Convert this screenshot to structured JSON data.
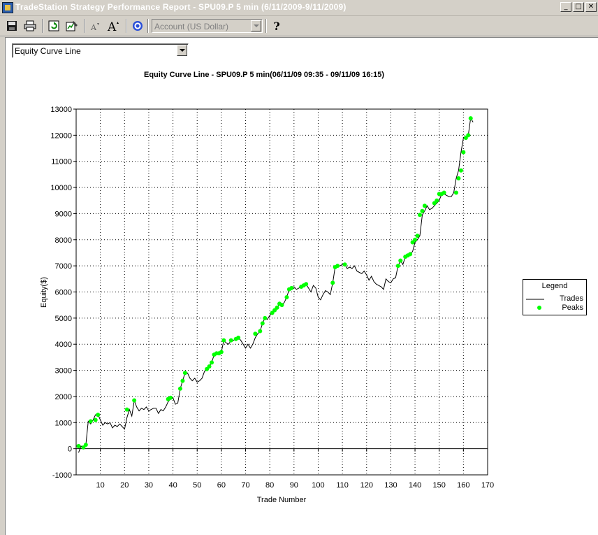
{
  "window": {
    "title": "TradeStation Strategy Performance Report - SPU09.P 5 min (6/11/2009-9/11/2009)",
    "minimize": "_",
    "maximize": "□",
    "close": "✕"
  },
  "toolbar": {
    "account_select": "Account (US Dollar)",
    "icons": [
      "save-icon",
      "print-icon",
      "refresh-icon",
      "settings-icon",
      "font-smaller-icon",
      "font-larger-icon",
      "target-icon",
      "help-icon"
    ],
    "help": "?"
  },
  "view_select": {
    "value": "Equity Curve Line"
  },
  "chart_data": {
    "type": "line",
    "title": "Equity Curve Line - SPU09.P 5 min(06/11/09 09:35 - 09/11/09 16:15)",
    "xlabel": "Trade Number",
    "ylabel": "Equity($)",
    "xlim": [
      0,
      170
    ],
    "ylim": [
      -1000,
      13000
    ],
    "xticks": [
      10,
      20,
      30,
      40,
      50,
      60,
      70,
      80,
      90,
      100,
      110,
      120,
      130,
      140,
      150,
      160,
      170
    ],
    "yticks": [
      -1000,
      0,
      1000,
      2000,
      3000,
      4000,
      5000,
      6000,
      7000,
      8000,
      9000,
      10000,
      11000,
      12000,
      13000
    ],
    "grid": true,
    "legend": {
      "title": "Legend",
      "position": "right",
      "entries": [
        "Trades",
        "Peaks"
      ]
    },
    "colors": {
      "trades": "#000000",
      "peaks": "#00ff00"
    },
    "series": [
      {
        "name": "Trades",
        "x": [
          1,
          2,
          3,
          4,
          5,
          6,
          7,
          8,
          9,
          10,
          11,
          12,
          13,
          14,
          15,
          16,
          17,
          18,
          19,
          20,
          21,
          22,
          23,
          24,
          25,
          26,
          27,
          28,
          29,
          30,
          31,
          32,
          33,
          34,
          35,
          36,
          37,
          38,
          39,
          40,
          41,
          42,
          43,
          44,
          45,
          46,
          47,
          48,
          49,
          50,
          51,
          52,
          53,
          54,
          55,
          56,
          57,
          58,
          59,
          60,
          61,
          62,
          63,
          64,
          65,
          66,
          67,
          68,
          69,
          70,
          71,
          72,
          73,
          74,
          75,
          76,
          77,
          78,
          79,
          80,
          81,
          82,
          83,
          84,
          85,
          86,
          87,
          88,
          89,
          90,
          91,
          92,
          93,
          94,
          95,
          96,
          97,
          98,
          99,
          100,
          101,
          102,
          103,
          104,
          105,
          106,
          107,
          108,
          109,
          110,
          111,
          112,
          113,
          114,
          115,
          116,
          117,
          118,
          119,
          120,
          121,
          122,
          123,
          124,
          125,
          126,
          127,
          128,
          129,
          130,
          131,
          132,
          133,
          134,
          135,
          136,
          137,
          138,
          139,
          140,
          141,
          142,
          143,
          144,
          145,
          146,
          147,
          148,
          149,
          150,
          151,
          152,
          153,
          154,
          155,
          156,
          157,
          158,
          159,
          160,
          161,
          162,
          163,
          164
        ],
        "y": [
          -150,
          100,
          50,
          150,
          1050,
          950,
          1100,
          1300,
          1320,
          1100,
          900,
          1000,
          950,
          1000,
          800,
          900,
          850,
          950,
          850,
          750,
          1200,
          1500,
          1250,
          1850,
          1600,
          1450,
          1550,
          1500,
          1600,
          1450,
          1500,
          1550,
          1550,
          1350,
          1500,
          1450,
          1600,
          1800,
          1900,
          1950,
          1700,
          1750,
          2300,
          2600,
          2900,
          2900,
          2700,
          2600,
          2700,
          2550,
          2600,
          2700,
          2950,
          3050,
          3150,
          3300,
          3600,
          3650,
          3650,
          3700,
          4150,
          4050,
          4000,
          4150,
          4150,
          4200,
          4250,
          4150,
          4000,
          3850,
          4000,
          3850,
          4000,
          4250,
          4400,
          4500,
          4800,
          5000,
          4950,
          5100,
          5200,
          5300,
          5400,
          5550,
          5500,
          5600,
          5800,
          6100,
          6150,
          6200,
          6100,
          6150,
          6200,
          6250,
          6300,
          6150,
          6000,
          6250,
          6150,
          5800,
          5700,
          5900,
          6050,
          6000,
          5900,
          6350,
          6950,
          7000,
          7000,
          7050,
          7050,
          6900,
          6950,
          6900,
          7000,
          6800,
          6750,
          6700,
          6800,
          6650,
          6450,
          6600,
          6400,
          6300,
          6250,
          6200,
          6100,
          6500,
          6400,
          6350,
          6500,
          6550,
          7000,
          7200,
          7050,
          7350,
          7400,
          7450,
          7550,
          7900,
          8000,
          8150,
          8950,
          9100,
          9300,
          9150,
          9200,
          9300,
          9400,
          9500,
          9750,
          9750,
          9700,
          9650,
          9650,
          9800,
          10350,
          10650,
          11350,
          11900,
          11950,
          12000,
          12650,
          12500
        ]
      },
      {
        "name": "Peaks",
        "x": [
          1,
          3,
          4,
          6,
          8,
          9,
          21,
          24,
          38,
          39,
          43,
          44,
          45,
          54,
          55,
          56,
          57,
          58,
          59,
          60,
          61,
          64,
          66,
          67,
          74,
          76,
          77,
          78,
          81,
          82,
          83,
          84,
          85,
          87,
          88,
          89,
          93,
          94,
          95,
          106,
          107,
          108,
          111,
          133,
          134,
          136,
          137,
          138,
          139,
          140,
          141,
          142,
          143,
          144,
          148,
          149,
          150,
          151,
          152,
          157,
          158,
          159,
          160,
          161,
          162,
          163
        ],
        "y": [
          100,
          50,
          150,
          1050,
          1100,
          1300,
          1500,
          1850,
          1900,
          1950,
          2300,
          2600,
          2900,
          3050,
          3150,
          3300,
          3600,
          3650,
          3650,
          3700,
          4150,
          4150,
          4200,
          4250,
          4400,
          4500,
          4800,
          5000,
          5200,
          5300,
          5400,
          5550,
          5500,
          5800,
          6100,
          6150,
          6200,
          6250,
          6300,
          6350,
          6950,
          7000,
          7050,
          7000,
          7200,
          7350,
          7400,
          7450,
          7900,
          8000,
          8150,
          8950,
          9100,
          9300,
          9400,
          9500,
          9750,
          9750,
          9800,
          9800,
          10350,
          10650,
          11350,
          11900,
          12000,
          12650
        ]
      }
    ]
  }
}
